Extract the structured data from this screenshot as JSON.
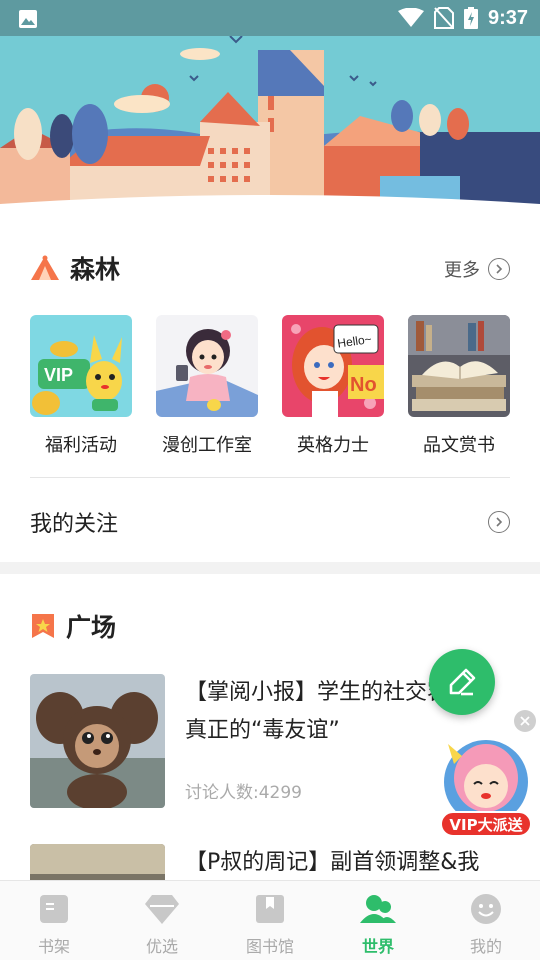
{
  "status_bar": {
    "time": "9:37"
  },
  "forest": {
    "title": "森林",
    "more_label": "更多",
    "apps": [
      {
        "label": "福利活动"
      },
      {
        "label": "漫创工作室"
      },
      {
        "label": "英格力士"
      },
      {
        "label": "品文赏书"
      }
    ],
    "follow_label": "我的关注"
  },
  "plaza": {
    "title": "广场",
    "posts": [
      {
        "title": "【掌阅小报】学生的社交容忍，真正的“毒友谊”",
        "meta": "讨论人数:4299"
      },
      {
        "title": "【P叔的周记】副首领调整&我",
        "meta": ""
      }
    ]
  },
  "vip_promo": {
    "label": "VIP大派送"
  },
  "bottom_nav": {
    "items": [
      {
        "label": "书架"
      },
      {
        "label": "优选"
      },
      {
        "label": "图书馆"
      },
      {
        "label": "世界"
      },
      {
        "label": "我的"
      }
    ],
    "active_index": 3
  },
  "colors": {
    "accent": "#2ebd6b",
    "status_bar": "#5e9aa0",
    "vip_red": "#e8322c"
  }
}
